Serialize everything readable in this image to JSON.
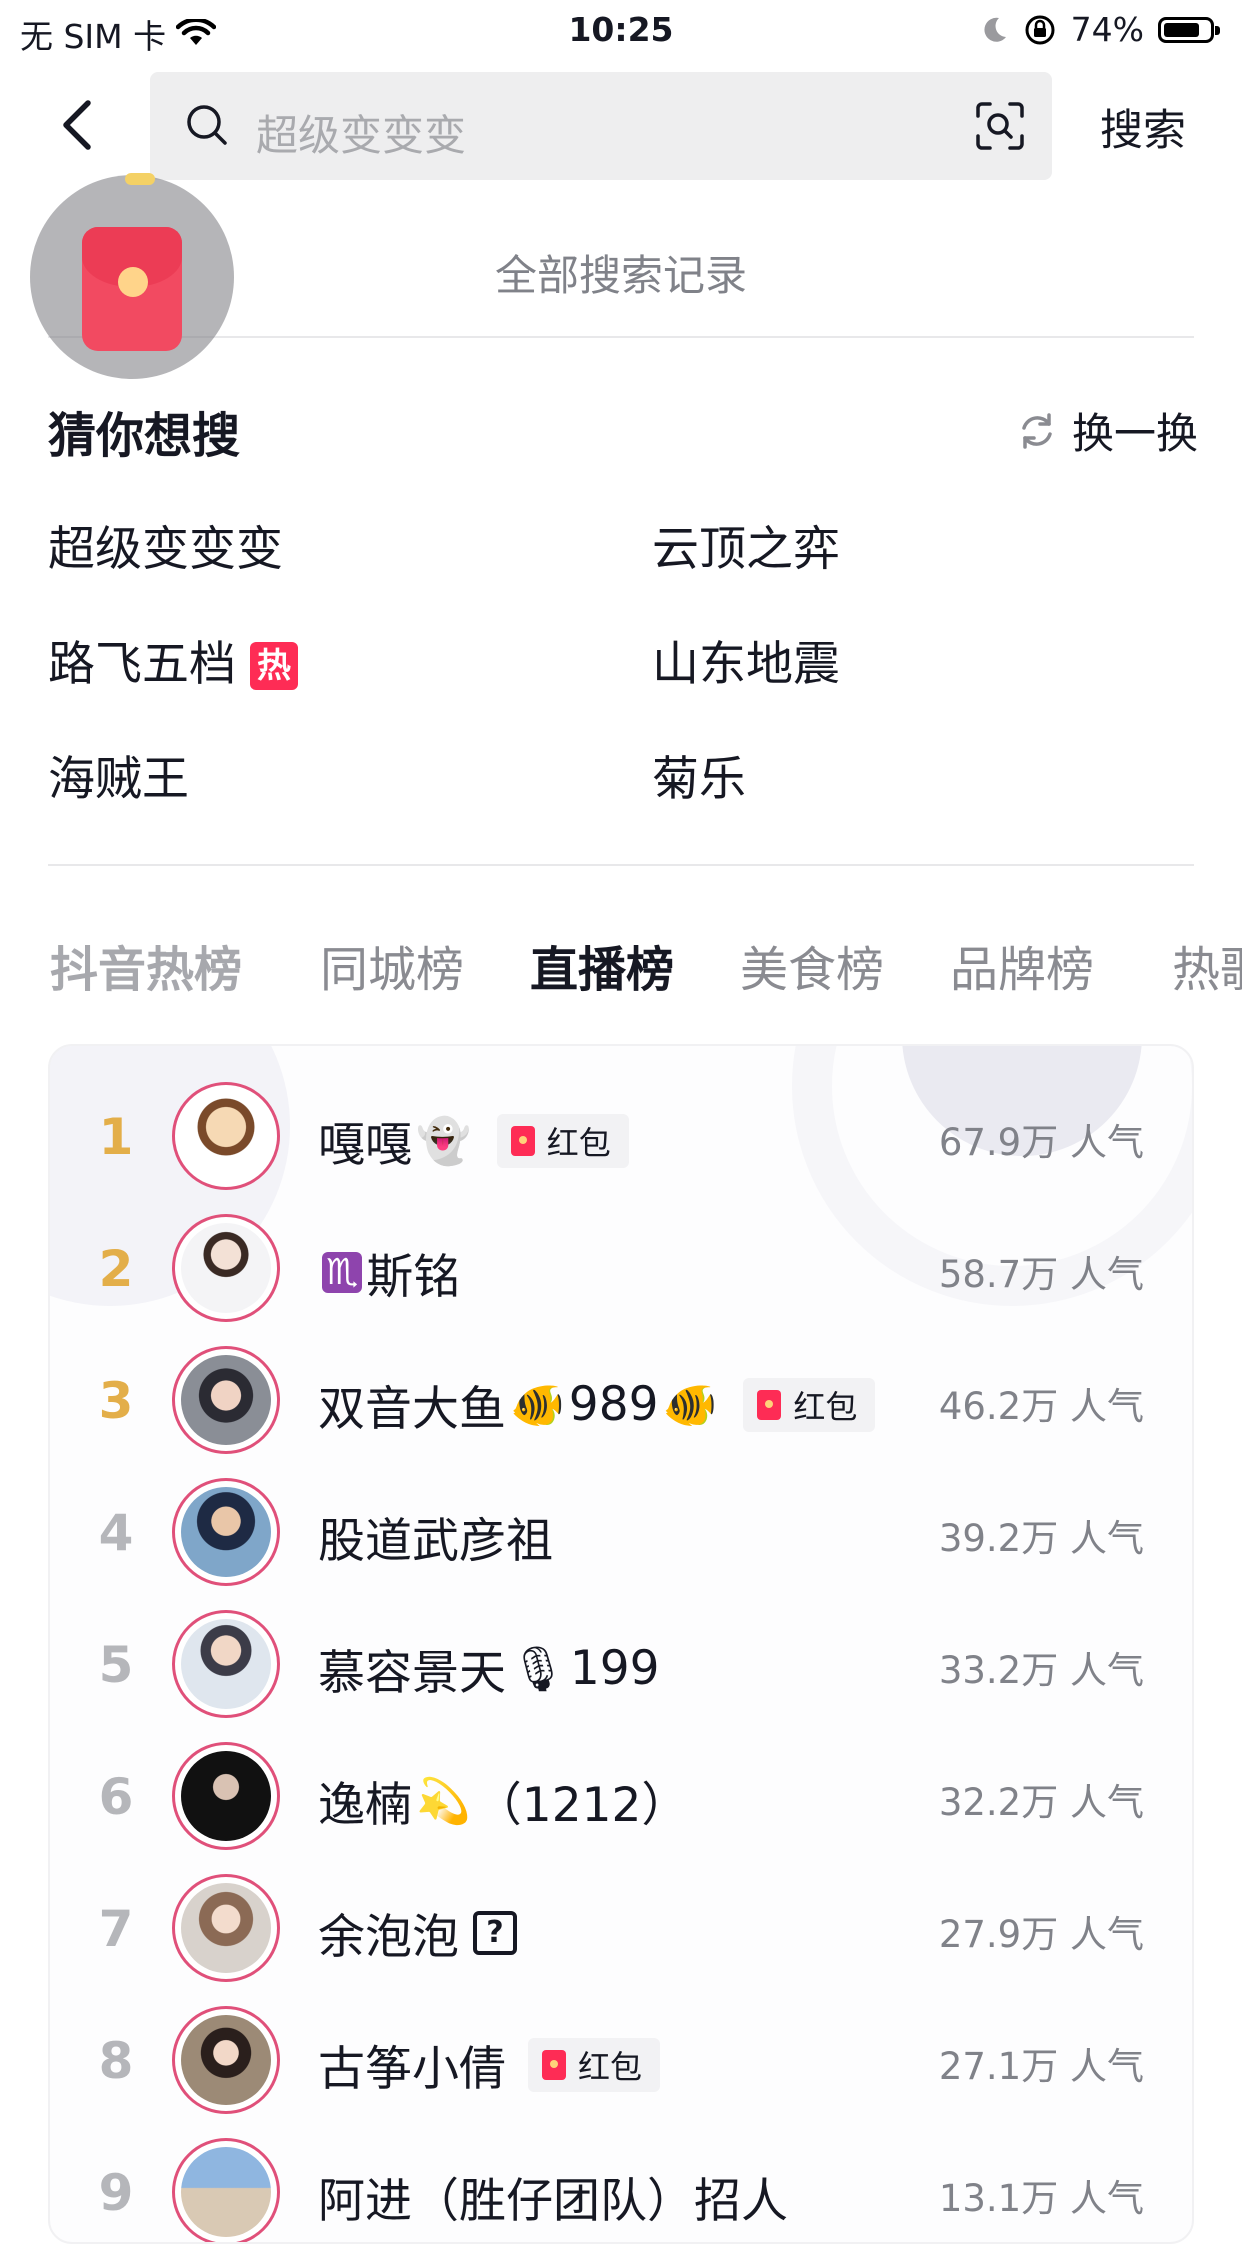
{
  "status_bar": {
    "carrier": "无 SIM 卡",
    "time": "10:25",
    "battery": "74%",
    "battery_level": 0.74
  },
  "search": {
    "placeholder": "超级变变变",
    "button": "搜索"
  },
  "history": {
    "link": "全部搜索记录"
  },
  "guess": {
    "title": "猜你想搜",
    "refresh": "换一换",
    "items": [
      "超级变变变",
      "云顶之弈",
      "路飞五档",
      "山东地震",
      "海贼王",
      "菊乐"
    ],
    "hot_badge": "热"
  },
  "tabs": [
    "抖音热榜",
    "同城榜",
    "直播榜",
    "美食榜",
    "品牌榜",
    "热歌"
  ],
  "active_tab": "直播榜",
  "red_packet_label": "红包",
  "live_list": [
    {
      "rank": "1",
      "name": "嘎嘎",
      "emoji": "👻",
      "badge": "红包",
      "score": "67.9万 人气"
    },
    {
      "rank": "2",
      "name": "斯铭",
      "emoji_before": "♏",
      "score": "58.7万 人气"
    },
    {
      "rank": "3",
      "name": "双音大鱼",
      "emoji": "🐠",
      "extra": "989",
      "emoji2": "🐠",
      "badge": "红包",
      "score": "46.2万 人气"
    },
    {
      "rank": "4",
      "name": "股道武彦祖",
      "score": "39.2万 人气"
    },
    {
      "rank": "5",
      "name": "慕容景天",
      "emoji": "🎙",
      "extra": "199",
      "score": "33.2万 人气"
    },
    {
      "rank": "6",
      "name": "逸楠",
      "emoji": "💫",
      "extra": "（1212）",
      "score": "32.2万 人气"
    },
    {
      "rank": "7",
      "name": "余泡泡",
      "q": "?",
      "score": "27.9万 人气"
    },
    {
      "rank": "8",
      "name": "古筝小倩",
      "badge": "红包",
      "score": "27.1万 人气"
    },
    {
      "rank": "9",
      "name": "阿进（胜仔团队）招人",
      "score": "13.1万 人气"
    }
  ]
}
